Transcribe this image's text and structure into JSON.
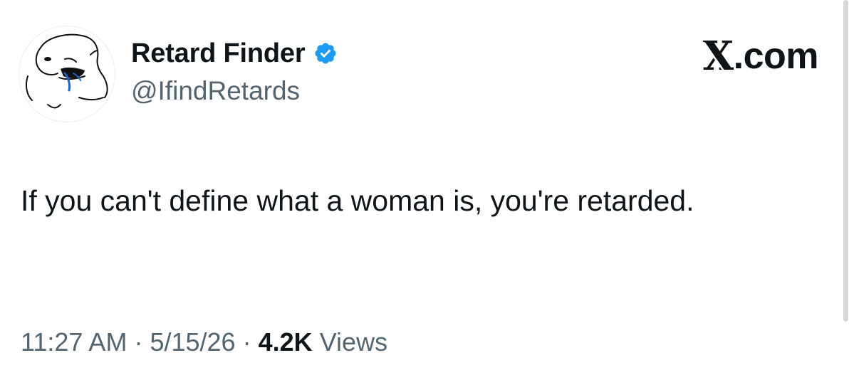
{
  "author": {
    "display_name": "Retard Finder",
    "handle": "@IfindRetards",
    "verified": true,
    "verified_color": "#1d9bf0"
  },
  "brand": {
    "icon": "x-logo-icon",
    "label": ".com"
  },
  "post": {
    "text": "If you can't define what a woman is, you're retarded."
  },
  "meta": {
    "time": "11:27 AM",
    "separator": "·",
    "date": "5/15/26",
    "views_count": "4.2K",
    "views_label": "Views"
  },
  "colors": {
    "text": "#0f1419",
    "secondary": "#536471",
    "background": "#ffffff"
  }
}
